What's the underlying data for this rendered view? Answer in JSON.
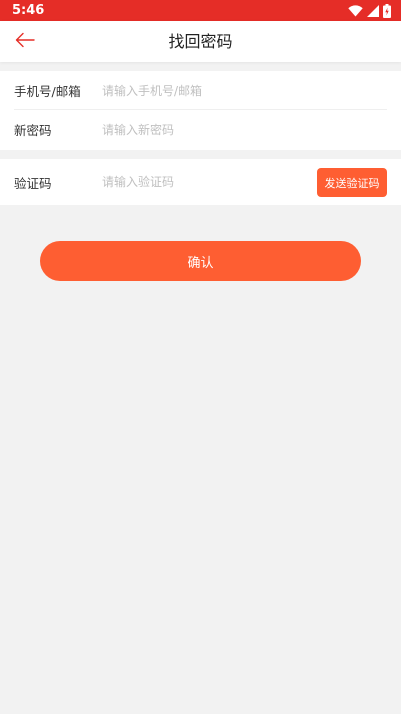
{
  "status_bar": {
    "time": "5:46",
    "icons": [
      "wifi-icon",
      "cell-signal-icon",
      "battery-charging-icon"
    ],
    "background": "#e52d27"
  },
  "app_bar": {
    "title": "找回密码",
    "back_icon": "arrow-left-icon",
    "back_icon_color": "#e52d27"
  },
  "form": {
    "phone_email": {
      "label": "手机号/邮箱",
      "value": "",
      "placeholder": "请输入手机号/邮箱"
    },
    "new_password": {
      "label": "新密码",
      "value": "",
      "placeholder": "请输入新密码"
    },
    "verification_code": {
      "label": "验证码",
      "value": "",
      "placeholder": "请输入验证码",
      "send_button_label": "发送验证码"
    }
  },
  "confirm_button_label": "确认",
  "colors": {
    "accent": "#fe5e32",
    "status_bar": "#e52d27",
    "background": "#f2f2f2"
  }
}
